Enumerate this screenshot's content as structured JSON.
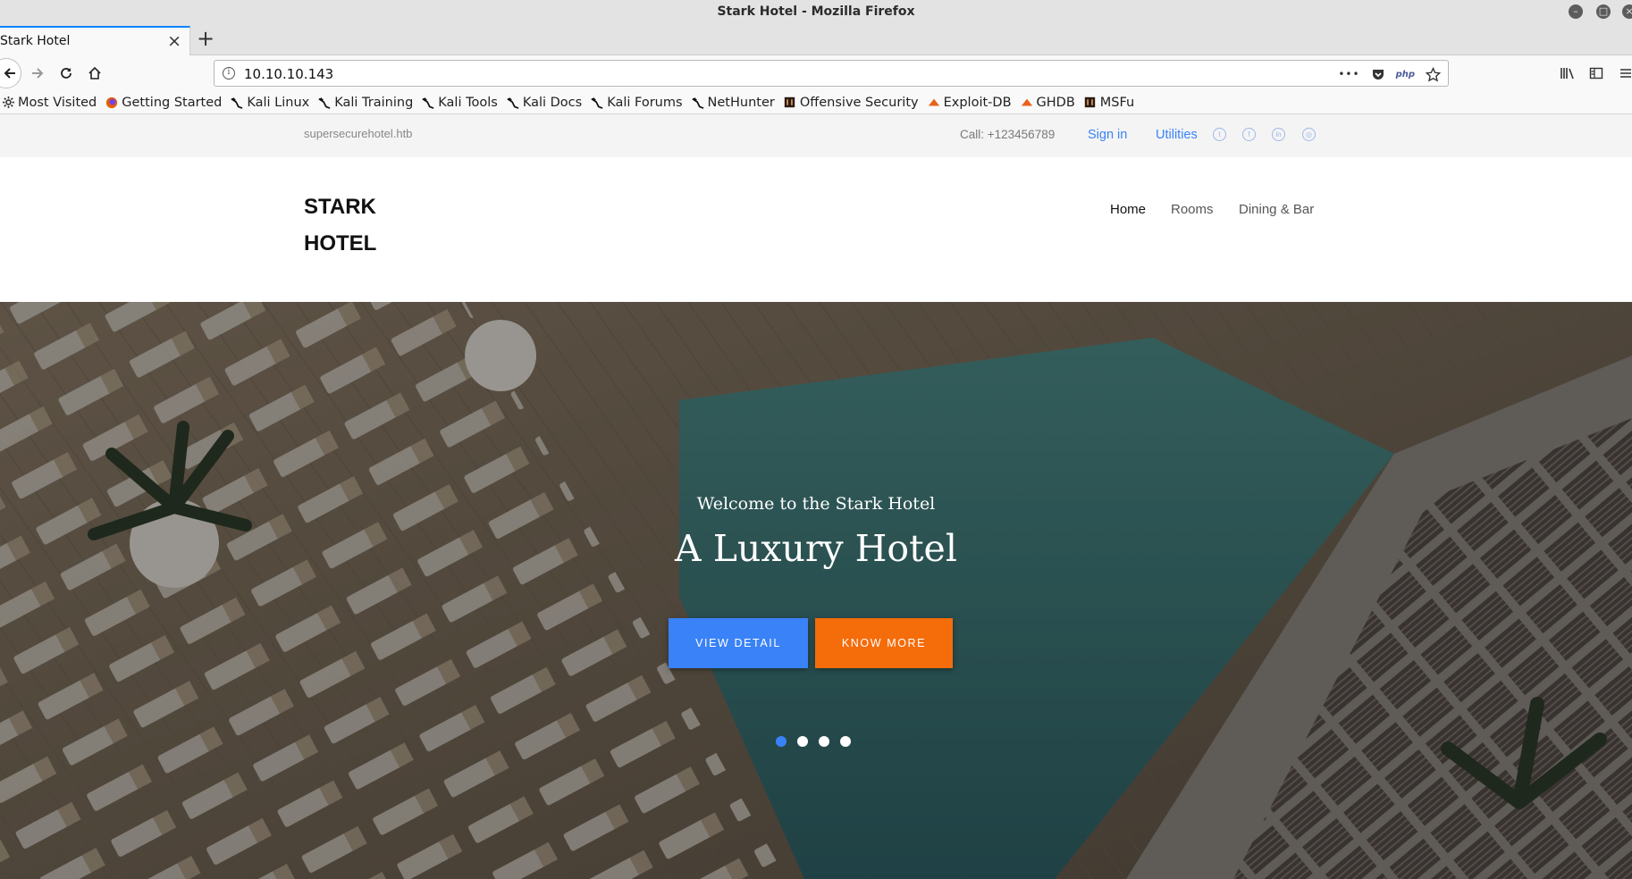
{
  "browser": {
    "window_title": "Stark Hotel - Mozilla Firefox",
    "tab_title": "Stark Hotel",
    "tab_close": "×",
    "new_tab": "+",
    "url": "10.10.10.143",
    "url_menu": "•••",
    "url_php": "php",
    "bookmarks": [
      {
        "label": "Most Visited",
        "icon": "gear-icon"
      },
      {
        "label": "Getting Started",
        "icon": "firefox-icon"
      },
      {
        "label": "Kali Linux",
        "icon": "kali-dragon-icon"
      },
      {
        "label": "Kali Training",
        "icon": "kali-dragon-icon"
      },
      {
        "label": "Kali Tools",
        "icon": "kali-dragon-icon"
      },
      {
        "label": "Kali Docs",
        "icon": "kali-dragon-icon"
      },
      {
        "label": "Kali Forums",
        "icon": "kali-dragon-icon"
      },
      {
        "label": "NetHunter",
        "icon": "kali-dragon-icon"
      },
      {
        "label": "Offensive Security",
        "icon": "offsec-icon"
      },
      {
        "label": "Exploit-DB",
        "icon": "exploitdb-icon"
      },
      {
        "label": "GHDB",
        "icon": "exploitdb-icon"
      },
      {
        "label": "MSFu",
        "icon": "offsec-icon"
      }
    ]
  },
  "site": {
    "topbar": {
      "domain": "supersecurehotel.htb",
      "call": "Call: +123456789",
      "signin": "Sign in",
      "utilities": "Utilities",
      "social_icons": [
        "twitter-icon",
        "facebook-icon",
        "linkedin-icon",
        "instagram-icon"
      ]
    },
    "logo_line1": "STARK",
    "logo_line2": "HOTEL",
    "nav": [
      "Home",
      "Rooms",
      "Dining & Bar"
    ],
    "hero": {
      "subtitle": "Welcome to the Stark Hotel",
      "title": "A Luxury Hotel",
      "btn_primary": "VIEW DETAIL",
      "btn_secondary": "KNOW MORE",
      "slides": 4,
      "active_slide": 1
    }
  },
  "colors": {
    "accent_blue": "#3a82f7",
    "accent_orange": "#f56c0a",
    "link": "#3b82f6"
  }
}
